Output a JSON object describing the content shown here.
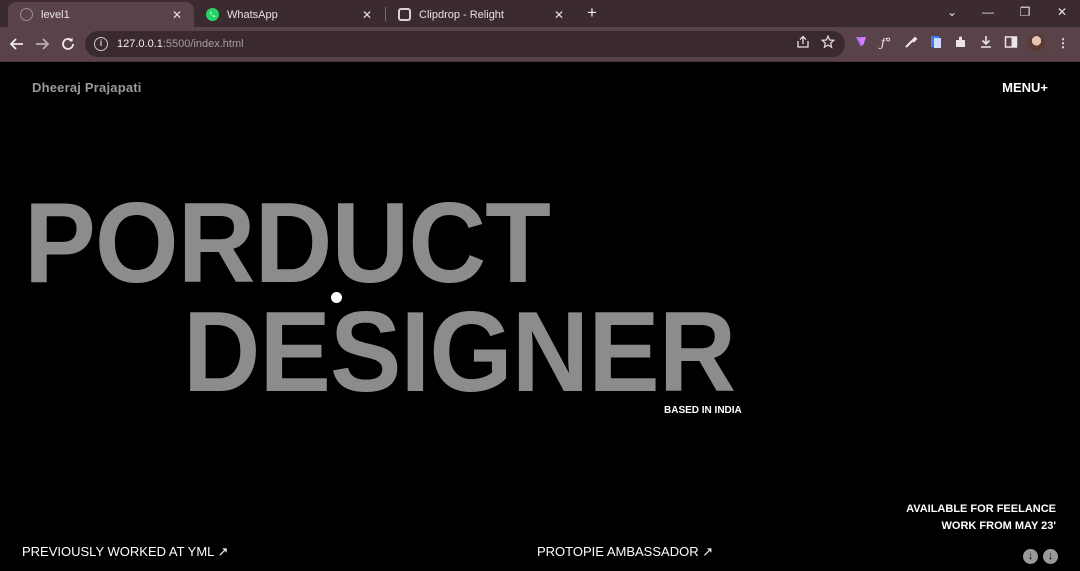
{
  "browser": {
    "tabs": [
      {
        "title": "level1",
        "active": true
      },
      {
        "title": "WhatsApp",
        "active": false
      },
      {
        "title": "Clipdrop - Relight",
        "active": false
      }
    ],
    "close_glyph": "✕",
    "new_tab_glyph": "+",
    "window_controls": {
      "dropdown": "⌄",
      "minimize": "—",
      "restore": "❐",
      "close": "✕"
    },
    "url": {
      "host": "127.0.0.1",
      "rest": ":5500/index.html"
    },
    "colors": {
      "frame": "#3b2b31",
      "toolbar": "#5a4249",
      "whatsapp": "#25d366"
    }
  },
  "page": {
    "brand": "Dheeraj Prajapati",
    "menu": "MENU+",
    "hero_line1": "PORDUCT",
    "hero_line2": "DESIGNER",
    "based": "BASED IN INDIA",
    "available_line1": "AVAILABLE FOR FEELANCE",
    "available_line2": "WORK FROM MAY 23'",
    "footer_left": "PREVIOUSLY WORKED AT YML ↗",
    "footer_mid": "PROTOPIE AMBASSADOR ↗",
    "scroll_glyph": "↓",
    "colors": {
      "background": "#000000",
      "hero_text": "#8c8c8c",
      "accent_text": "#ffffff"
    }
  }
}
